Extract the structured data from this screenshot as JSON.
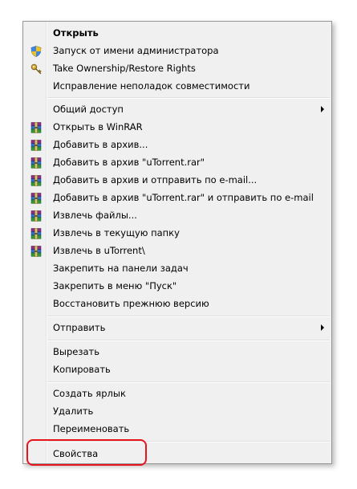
{
  "menu": {
    "items": [
      {
        "label": "Открыть",
        "icon": "",
        "bold": true,
        "submenu": false
      },
      {
        "label": "Запуск от имени администратора",
        "icon": "uac-shield-icon",
        "bold": false,
        "submenu": false
      },
      {
        "label": "Take Ownership/Restore Rights",
        "icon": "key-icon",
        "bold": false,
        "submenu": false
      },
      {
        "label": "Исправление неполадок совместимости",
        "icon": "",
        "bold": false,
        "submenu": false
      },
      {
        "label": "Общий доступ",
        "icon": "",
        "bold": false,
        "submenu": true
      },
      {
        "label": "Открыть в WinRAR",
        "icon": "winrar-icon",
        "bold": false,
        "submenu": false
      },
      {
        "label": "Добавить в архив...",
        "icon": "winrar-icon",
        "bold": false,
        "submenu": false
      },
      {
        "label": "Добавить в архив \"uTorrent.rar\"",
        "icon": "winrar-icon",
        "bold": false,
        "submenu": false
      },
      {
        "label": "Добавить в архив и отправить по e-mail...",
        "icon": "winrar-icon",
        "bold": false,
        "submenu": false
      },
      {
        "label": "Добавить в архив \"uTorrent.rar\" и отправить по e-mail",
        "icon": "winrar-icon",
        "bold": false,
        "submenu": false
      },
      {
        "label": "Извлечь файлы...",
        "icon": "winrar-icon",
        "bold": false,
        "submenu": false
      },
      {
        "label": "Извлечь в текущую папку",
        "icon": "winrar-icon",
        "bold": false,
        "submenu": false
      },
      {
        "label": "Извлечь в uTorrent\\",
        "icon": "winrar-icon",
        "bold": false,
        "submenu": false
      },
      {
        "label": "Закрепить на панели задач",
        "icon": "",
        "bold": false,
        "submenu": false
      },
      {
        "label": "Закрепить в меню \"Пуск\"",
        "icon": "",
        "bold": false,
        "submenu": false
      },
      {
        "label": "Восстановить прежнюю версию",
        "icon": "",
        "bold": false,
        "submenu": false
      },
      {
        "label": "Отправить",
        "icon": "",
        "bold": false,
        "submenu": true
      },
      {
        "label": "Вырезать",
        "icon": "",
        "bold": false,
        "submenu": false
      },
      {
        "label": "Копировать",
        "icon": "",
        "bold": false,
        "submenu": false
      },
      {
        "label": "Создать ярлык",
        "icon": "",
        "bold": false,
        "submenu": false
      },
      {
        "label": "Удалить",
        "icon": "",
        "bold": false,
        "submenu": false
      },
      {
        "label": "Переименовать",
        "icon": "",
        "bold": false,
        "submenu": false
      },
      {
        "label": "Свойства",
        "icon": "",
        "bold": false,
        "submenu": false
      }
    ]
  },
  "colors": {
    "menu_background": "#f0f0f0",
    "highlight_outline": "#e8141c"
  }
}
